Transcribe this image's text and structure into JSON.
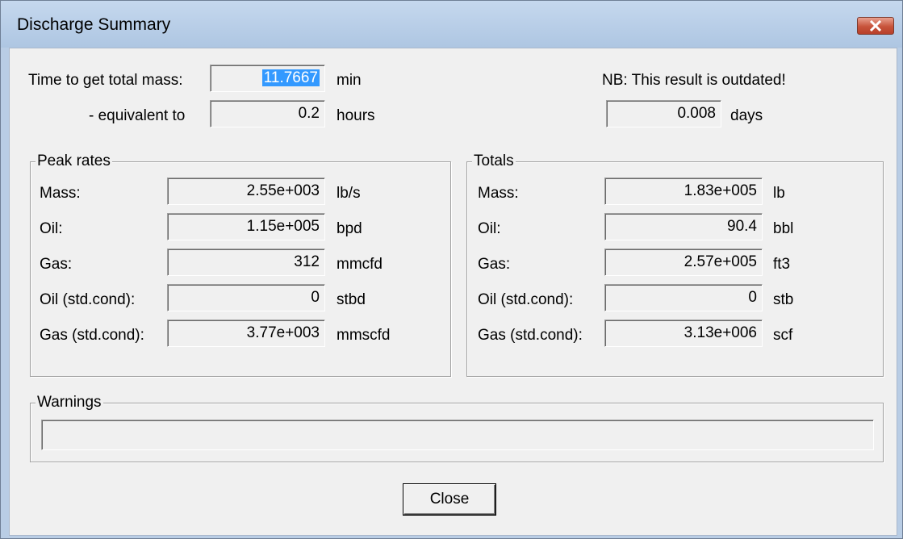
{
  "window": {
    "title": "Discharge Summary"
  },
  "top": {
    "time_label": "Time to get total mass:",
    "time_value": "11.7667",
    "time_unit": "min",
    "equiv_label": "- equivalent to",
    "hours_value": "0.2",
    "hours_unit": "hours",
    "note": "NB: This result is outdated!",
    "days_value": "0.008",
    "days_unit": "days"
  },
  "peak_rates": {
    "title": "Peak rates",
    "rows": [
      {
        "label": "Mass:",
        "value": "2.55e+003",
        "unit": "lb/s"
      },
      {
        "label": "Oil:",
        "value": "1.15e+005",
        "unit": "bpd"
      },
      {
        "label": "Gas:",
        "value": "312",
        "unit": "mmcfd"
      },
      {
        "label": "Oil (std.cond):",
        "value": "0",
        "unit": "stbd"
      },
      {
        "label": "Gas (std.cond):",
        "value": "3.77e+003",
        "unit": "mmscfd"
      }
    ]
  },
  "totals": {
    "title": "Totals",
    "rows": [
      {
        "label": "Mass:",
        "value": "1.83e+005",
        "unit": "lb"
      },
      {
        "label": "Oil:",
        "value": "90.4",
        "unit": "bbl"
      },
      {
        "label": "Gas:",
        "value": "2.57e+005",
        "unit": "ft3"
      },
      {
        "label": "Oil (std.cond):",
        "value": "0",
        "unit": "stb"
      },
      {
        "label": "Gas (std.cond):",
        "value": "3.13e+006",
        "unit": "scf"
      }
    ]
  },
  "warnings": {
    "title": "Warnings",
    "value": ""
  },
  "buttons": {
    "close_label": "Close"
  }
}
